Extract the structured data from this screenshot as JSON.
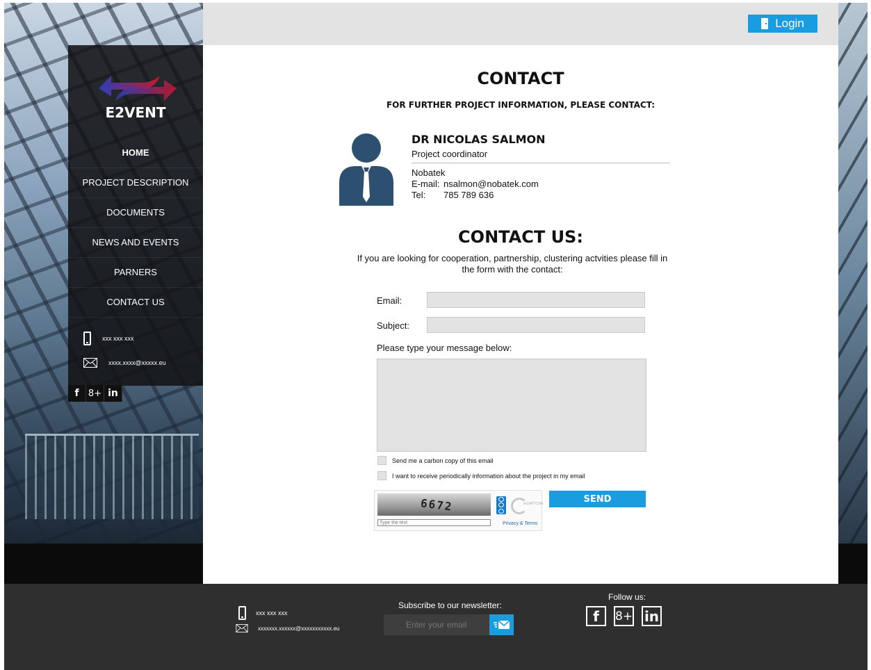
{
  "header": {
    "login_label": "Login"
  },
  "brand": {
    "name": "E2VENT"
  },
  "sidebar": {
    "items": [
      {
        "label": "HOME"
      },
      {
        "label": "PROJECT DESCRIPTION"
      },
      {
        "label": "DOCUMENTS"
      },
      {
        "label": "NEWS AND EVENTS"
      },
      {
        "label": "PARNERS"
      },
      {
        "label": "CONTACT US"
      }
    ],
    "phone": "xxx xxx xxx",
    "email": "xxxx.xxxx@xxxxx.eu",
    "social": {
      "facebook": "f",
      "google": "8+",
      "linkedin": "in"
    }
  },
  "contact": {
    "title": "CONTACT",
    "subtitle": "FOR FURTHER PROJECT INFORMATION, PLEASE CONTACT:",
    "name": "DR NICOLAS SALMON",
    "role": "Project coordinator",
    "org": "Nobatek",
    "email_label": "E-mail:",
    "email": "nsalmon@nobatek.com",
    "tel_label": "Tel:",
    "tel": "785 789 636"
  },
  "contact_us": {
    "title": "CONTACT US:",
    "text": "If you are looking for cooperation, partnership, clustering actvities please fill in the form with the contact:",
    "email_label": "Email:",
    "subject_label": "Subject:",
    "message_label": "Please type your message below:",
    "check_copy": "Send me a carbon copy of this email",
    "check_info": "I want to receive periodically information about the project in my email",
    "captcha_code": "6672",
    "captcha_placeholder": "Type the text",
    "captcha_privacy": "Privacy & Terms",
    "captcha_brand": "reCAPTCHA",
    "send_label": "SEND"
  },
  "footer": {
    "phone": "xxx xxx xxx",
    "email": "xxxxxxx.xxxxxx@xxxxxxxxxxx.eu",
    "newsletter_label": "Subscribe to our newsletter:",
    "newsletter_placeholder": "Enter your email",
    "follow_label": "Follow us:",
    "social": {
      "facebook": "f",
      "google": "8+",
      "linkedin": "in"
    }
  },
  "colors": {
    "accent": "#1a9de0",
    "sidebar": "#121214",
    "footer": "#2f2f2f",
    "field": "#e3e3e3"
  }
}
